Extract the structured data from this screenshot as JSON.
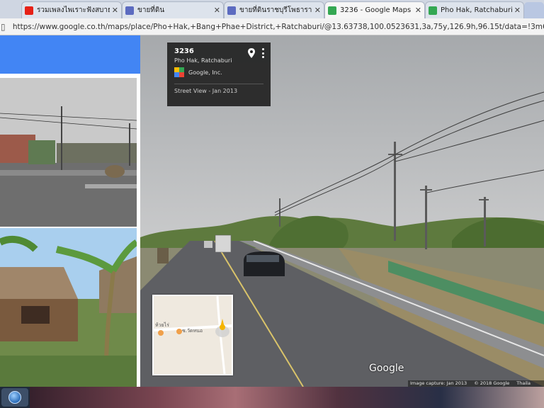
{
  "browser": {
    "tabs": [
      {
        "label": "รวมเพลงไพเราะฟังสบาย",
        "icon": "youtube-icon",
        "color": "#e62117",
        "active": false
      },
      {
        "label": "ขายที่ดิน",
        "icon": "site-icon",
        "color": "#5c6bc0",
        "active": false
      },
      {
        "label": "ขายที่ดินราชบุรีโพธาราม",
        "icon": "site-icon",
        "color": "#5c6bc0",
        "active": false
      },
      {
        "label": "3236 - Google Maps",
        "icon": "google-maps-icon",
        "color": "#34a853",
        "active": true
      },
      {
        "label": "Pho Hak, Ratchaburi",
        "icon": "google-maps-icon",
        "color": "#34a853",
        "active": false
      }
    ],
    "url": "https://www.google.co.th/maps/place/Pho+Hak,+Bang+Phae+District,+Ratchaburi/@13.63738,100.0523631,3a,75y,126.9h,96.15t/data=!3m6!1e1!3m4!1"
  },
  "info_card": {
    "title": "3236",
    "subtitle": "Pho Hak, Ratchaburi",
    "owner": "Google, Inc.",
    "date": "Street View - Jan 2013"
  },
  "minimap": {
    "label_left": "ห้วยไร่",
    "label_right": "ซ.วัดหนอ"
  },
  "street_view": {
    "watermark": "Google",
    "footer": [
      "Image capture: Jan 2013",
      "© 2018 Google",
      "Thaila"
    ]
  },
  "colors": {
    "accent": "#4285f4",
    "card_bg": "#222222",
    "tabbar_bg": "#cfd6e2"
  }
}
